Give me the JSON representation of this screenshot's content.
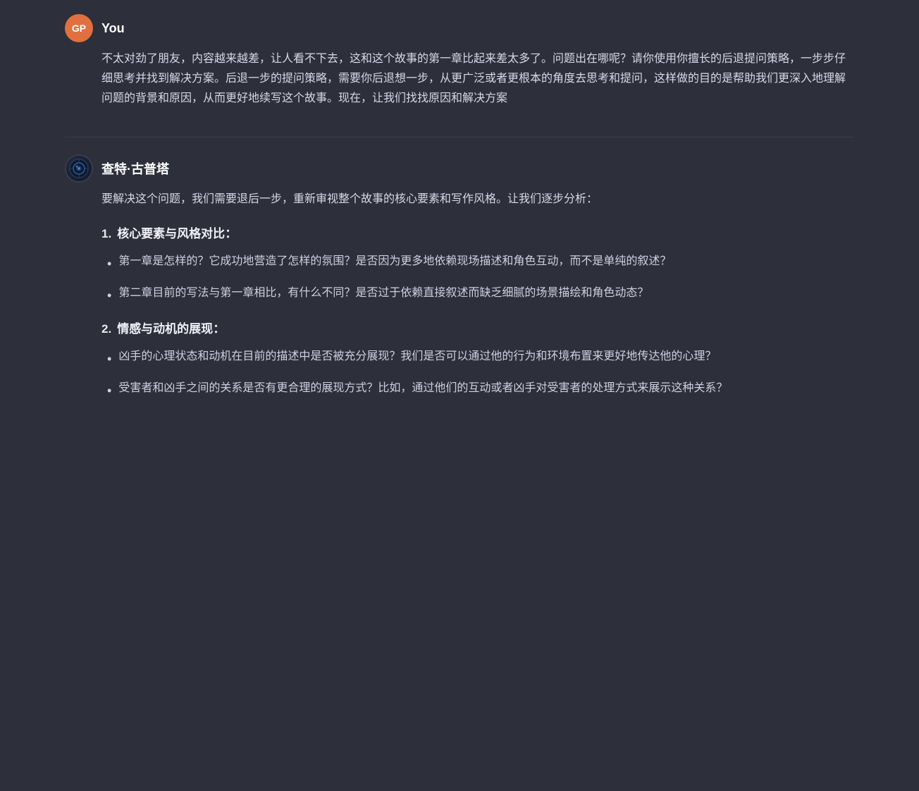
{
  "user": {
    "avatar_label": "GP",
    "username": "You",
    "message": "不太对劲了朋友，内容越来越差，让人看不下去，这和这个故事的第一章比起来差太多了。问题出在哪呢？请你使用你擅长的后退提问策略，一步步仔细思考并找到解决方案。后退一步的提问策略，需要你后退想一步，从更广泛或者更根本的角度去思考和提问，这样做的目的是帮助我们更深入地理解问题的背景和原因，从而更好地续写这个故事。现在，让我们找找原因和解决方案"
  },
  "bot": {
    "username": "查特·古普塔",
    "intro": "要解决这个问题，我们需要退后一步，重新审视整个故事的核心要素和写作风格。让我们逐步分析：",
    "sections": [
      {
        "number": "1.",
        "title": "核心要素与风格对比",
        "colon": "：",
        "bullets": [
          "第一章是怎样的？它成功地营造了怎样的氛围？是否因为更多地依赖现场描述和角色互动，而不是单纯的叙述？",
          "第二章目前的写法与第一章相比，有什么不同？是否过于依赖直接叙述而缺乏细腻的场景描绘和角色动态？"
        ]
      },
      {
        "number": "2.",
        "title": "情感与动机的展现",
        "colon": "：",
        "bullets": [
          "凶手的心理状态和动机在目前的描述中是否被充分展现？我们是否可以通过他的行为和环境布置来更好地传达他的心理？",
          "受害者和凶手之间的关系是否有更合理的展现方式？比如，通过他们的互动或者凶手对受害者的处理方式来展示这种关系？"
        ]
      }
    ]
  },
  "icons": {
    "bullet": "•",
    "bot_emoji": "🤖"
  }
}
